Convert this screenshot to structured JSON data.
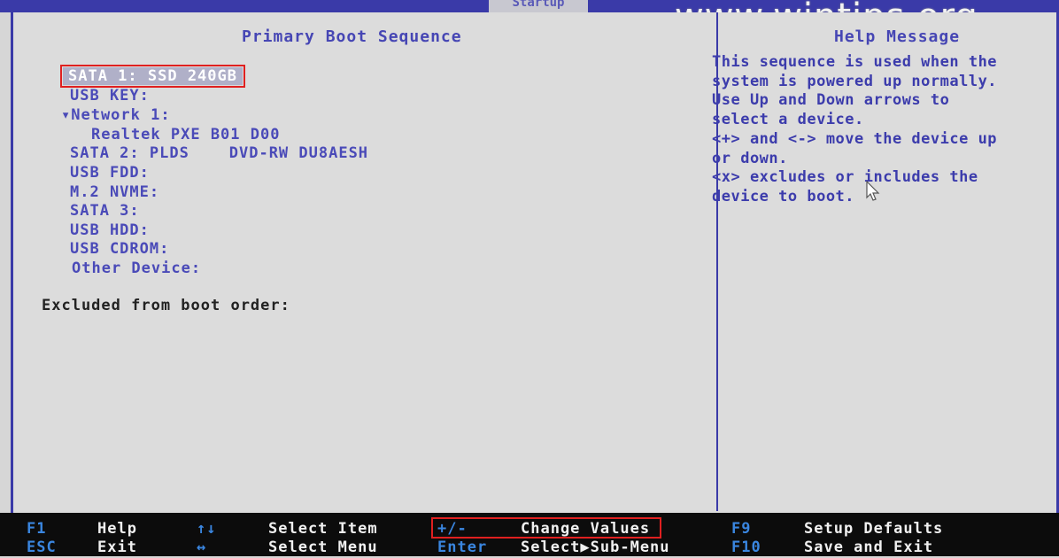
{
  "header": {
    "tab_label": "Startup",
    "watermark": "www.wintips.org"
  },
  "left_pane": {
    "title": "Primary Boot Sequence",
    "items": [
      {
        "label": "SATA 1: SSD 240GB"
      },
      {
        "label": "USB KEY:"
      },
      {
        "label": "▾Network 1:"
      },
      {
        "label": "Realtek PXE B01 D00"
      },
      {
        "label": "SATA 2: PLDS    DVD-RW DU8AESH"
      },
      {
        "label": "USB FDD:"
      },
      {
        "label": "M.2 NVME:"
      },
      {
        "label": "SATA 3:"
      },
      {
        "label": "USB HDD:"
      },
      {
        "label": "USB CDROM:"
      },
      {
        "label": "Other Device:"
      }
    ],
    "excluded_label": "Excluded from boot order:"
  },
  "right_pane": {
    "title": "Help Message",
    "text": "This sequence is used when the\nsystem is powered up normally.\nUse Up and Down arrows to\nselect a device.\n<+> and <-> move the device up\nor down.\n<x> excludes or includes the\ndevice to boot."
  },
  "footer": {
    "row1": [
      {
        "key": "F1",
        "desc": "Help"
      },
      {
        "key": "↑↓",
        "desc": "Select Item"
      },
      {
        "key": "+/-",
        "desc": "Change Values"
      },
      {
        "key": "F9",
        "desc": "Setup Defaults"
      }
    ],
    "row2": [
      {
        "key": "ESC",
        "desc": "Exit"
      },
      {
        "key": "↔",
        "desc": "Select Menu"
      },
      {
        "key": "Enter",
        "desc": "Select▶Sub-Menu"
      },
      {
        "key": "F10",
        "desc": "Save and Exit"
      }
    ]
  },
  "colors": {
    "bios_blue": "#3a3aa8",
    "text_blue": "#4a4ab8",
    "key_blue": "#3a86e0",
    "highlight_red": "#e02020"
  }
}
